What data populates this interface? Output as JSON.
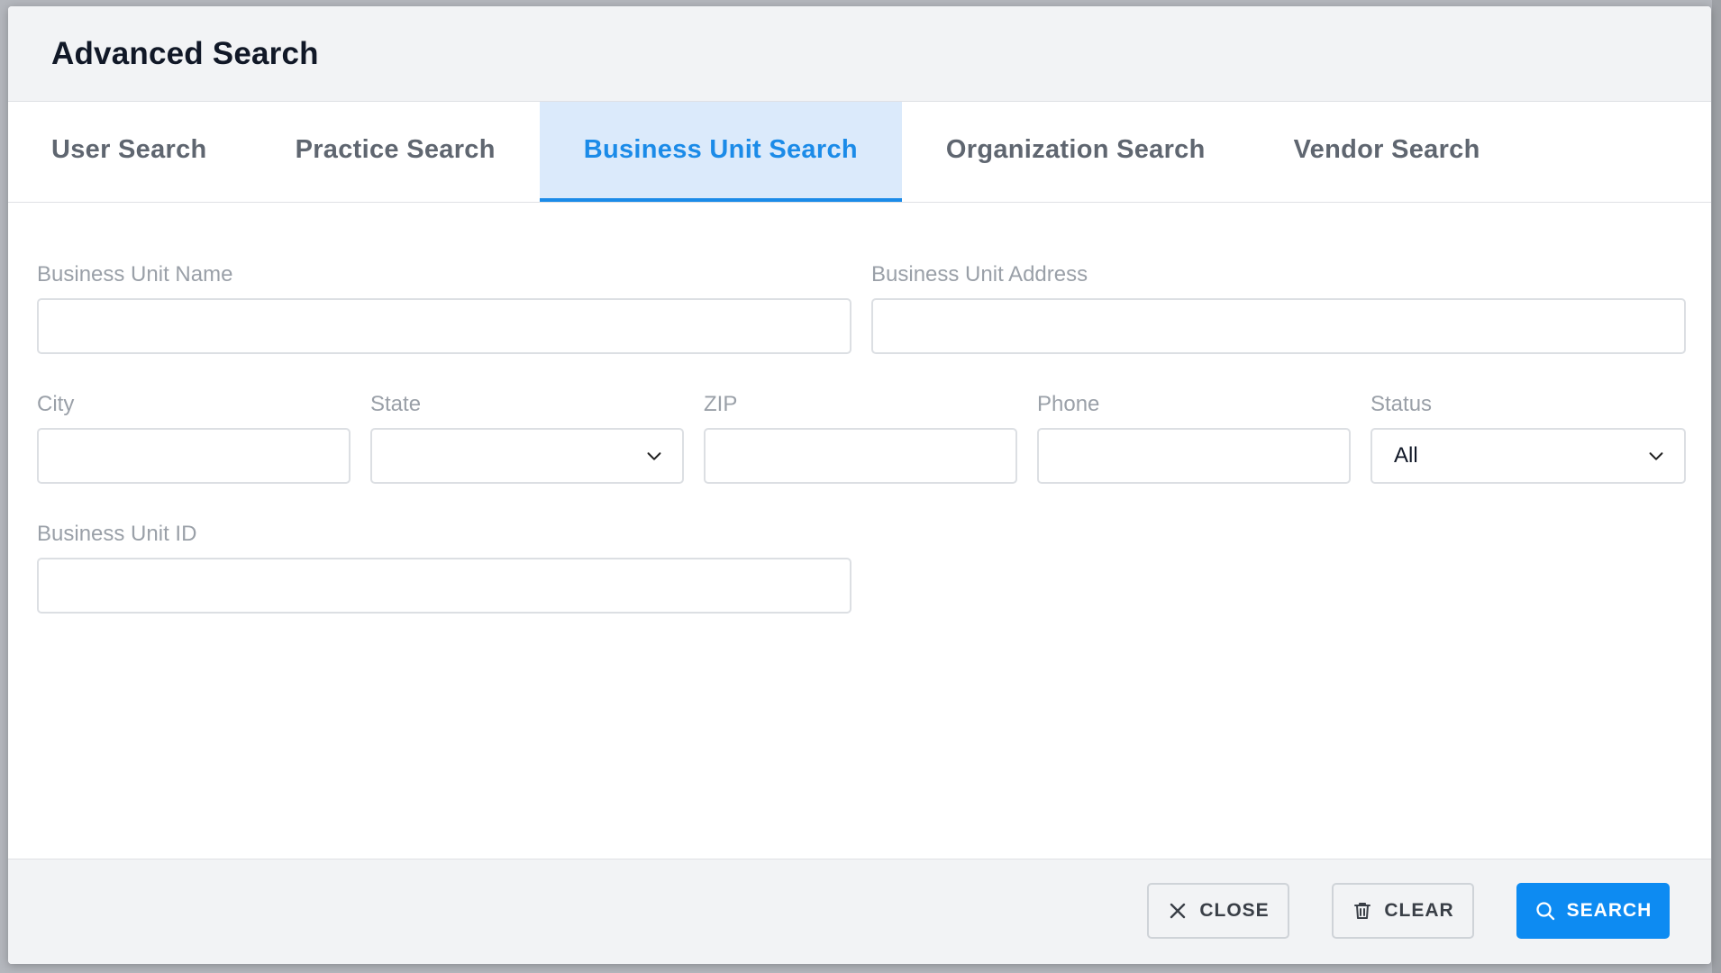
{
  "modal": {
    "title": "Advanced Search"
  },
  "tabs": [
    {
      "label": "User Search",
      "active": false
    },
    {
      "label": "Practice Search",
      "active": false
    },
    {
      "label": "Business Unit Search",
      "active": true
    },
    {
      "label": "Organization Search",
      "active": false
    },
    {
      "label": "Vendor Search",
      "active": false
    }
  ],
  "form": {
    "business_unit_name": {
      "label": "Business Unit Name",
      "value": ""
    },
    "business_unit_address": {
      "label": "Business Unit Address",
      "value": ""
    },
    "city": {
      "label": "City",
      "value": ""
    },
    "state": {
      "label": "State",
      "value": ""
    },
    "zip": {
      "label": "ZIP",
      "value": ""
    },
    "phone": {
      "label": "Phone",
      "value": ""
    },
    "status": {
      "label": "Status",
      "value": "All"
    },
    "business_unit_id": {
      "label": "Business Unit ID",
      "value": ""
    }
  },
  "footer": {
    "close_label": "CLOSE",
    "clear_label": "CLEAR",
    "search_label": "SEARCH"
  },
  "icons": {
    "close": "close-icon",
    "clear": "trash-icon",
    "search": "search-icon",
    "dropdown": "chevron-down-icon"
  },
  "colors": {
    "accent": "#1b8be8",
    "primary_button": "#0d8bf2",
    "active_tab_bg": "#dbeafb"
  }
}
